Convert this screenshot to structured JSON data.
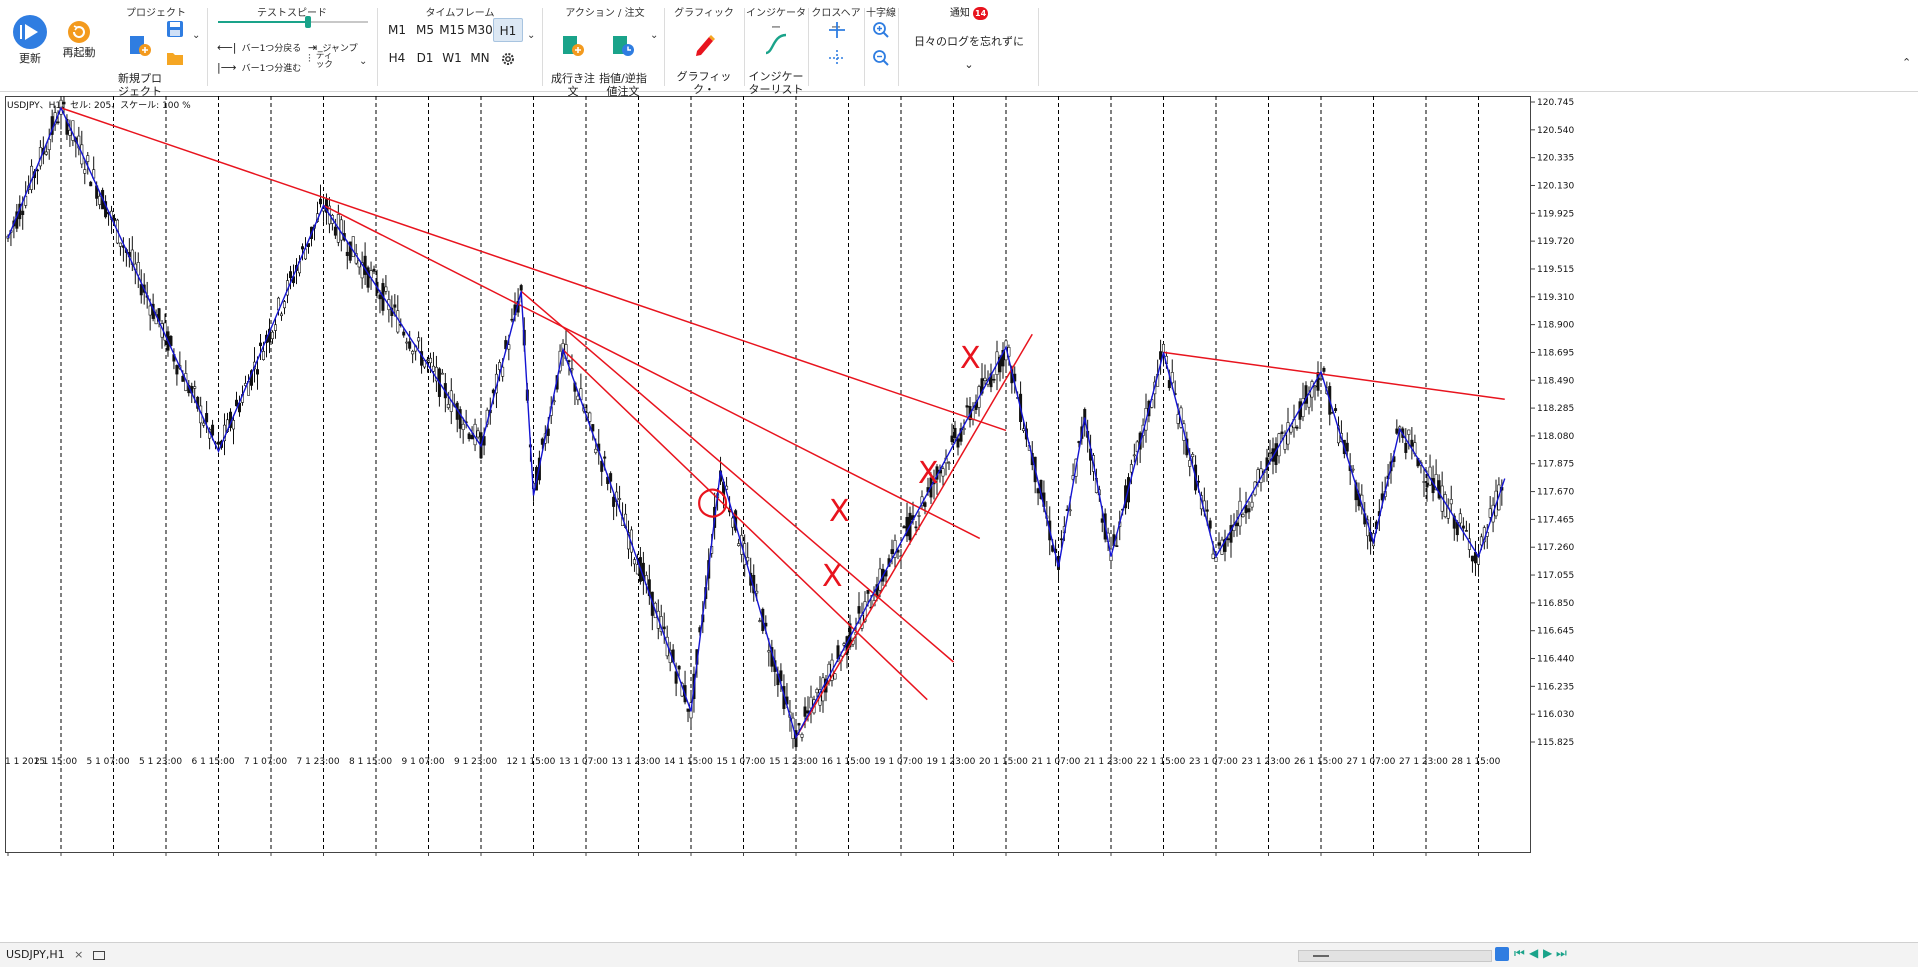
{
  "toolbar": {
    "refresh_label": "更新",
    "restart_label": "再起動",
    "project": {
      "title": "プロジェクト",
      "new_project_label": "新規プロ\nジェクト"
    },
    "test_speed": {
      "title": "テストスピード",
      "back_one_bar": "バー1つ分戻る",
      "forward_one_bar": "バー1つ分進む",
      "jump": "ジャンプ",
      "tick": "ティ\nック",
      "speed_fraction": 0.6
    },
    "timeframe": {
      "title": "タイムフレーム",
      "items": [
        "M1",
        "M5",
        "M15",
        "M30",
        "H1",
        "H4",
        "D1",
        "W1",
        "MN"
      ],
      "selected": "H1"
    },
    "action": {
      "title": "アクション / 注文",
      "market_order": "成行き注\n文",
      "limit_stop_order": "指値/逆指\n値注文"
    },
    "graphic": {
      "title": "グラフィック",
      "elements_label": "グラフィック・\nエレメント"
    },
    "indicator": {
      "title": "インジケーター",
      "list_label": "インジケー\nターリスト"
    },
    "crosshair": {
      "title": "クロスヘアー"
    },
    "cross_lines": {
      "title": "十字線"
    },
    "notification": {
      "title": "通知",
      "badge": "14",
      "message": "日々のログを忘れずに"
    }
  },
  "chart": {
    "info": "USDJPY、H1、セル: 205、スケール: 100 %",
    "price_labels": [
      "120.745",
      "120.540",
      "120.335",
      "120.130",
      "119.925",
      "119.720",
      "119.515",
      "119.310",
      "118.900",
      "118.695",
      "118.490",
      "118.285",
      "118.080",
      "117.875",
      "117.670",
      "117.465",
      "117.260",
      "117.055",
      "116.850",
      "116.645",
      "116.440",
      "116.235",
      "116.030",
      "115.825"
    ],
    "time_labels": [
      "1 1 2015",
      "2 1 15:00",
      "5 1 07:00",
      "5 1 23:00",
      "6 1 15:00",
      "7 1 07:00",
      "7 1 23:00",
      "8 1 15:00",
      "9 1 07:00",
      "9 1 23:00",
      "12 1 15:00",
      "13 1 07:00",
      "13 1 23:00",
      "14 1 15:00",
      "15 1 07:00",
      "15 1 23:00",
      "16 1 15:00",
      "19 1 07:00",
      "19 1 23:00",
      "20 1 15:00",
      "21 1 07:00",
      "21 1 23:00",
      "22 1 15:00",
      "23 1 07:00",
      "23 1 23:00",
      "26 1 15:00",
      "27 1 07:00",
      "27 1 23:00",
      "28 1 15:00"
    ],
    "marks": {
      "cross": "X",
      "circle": "○"
    },
    "colors": {
      "zigzag": "#1414d2",
      "trendline": "#e8141e",
      "candle": "#111111",
      "grid": "#000000"
    }
  },
  "chart_data": {
    "type": "candlestick",
    "symbol": "USDJPY",
    "timeframe": "H1",
    "ylim": [
      115.75,
      120.85
    ],
    "zigzag": [
      {
        "x": "1 1 2015",
        "y": 119.7
      },
      {
        "x": "2 1 15:00",
        "y": 120.7
      },
      {
        "x": "6 1 15:00",
        "y": 118.06
      },
      {
        "x": "7 1 23:00",
        "y": 119.95
      },
      {
        "x": "9 1 23:00",
        "y": 118.1
      },
      {
        "x": "12 1 00:00",
        "y": 119.29
      },
      {
        "x": "12 1 15:00",
        "y": 117.72
      },
      {
        "x": "13 1 00:00",
        "y": 118.84
      },
      {
        "x": "14 1 15:00",
        "y": 116.06
      },
      {
        "x": "15 1 00:00",
        "y": 117.91
      },
      {
        "x": "15 1 23:00",
        "y": 115.86
      },
      {
        "x": "20 1 15:00",
        "y": 118.86
      },
      {
        "x": "21 1 07:00",
        "y": 117.17
      },
      {
        "x": "21 1 15:00",
        "y": 118.32
      },
      {
        "x": "21 1 23:00",
        "y": 117.25
      },
      {
        "x": "22 1 15:00",
        "y": 118.82
      },
      {
        "x": "23 1 07:00",
        "y": 117.25
      },
      {
        "x": "26 1 15:00",
        "y": 118.67
      },
      {
        "x": "27 1 07:00",
        "y": 117.36
      },
      {
        "x": "27 1 15:00",
        "y": 118.23
      },
      {
        "x": "28 1 15:00",
        "y": 117.25
      },
      {
        "x": "28 1 23:00",
        "y": 117.85
      }
    ],
    "trendlines": [
      {
        "from": {
          "x": "2 1 15:00",
          "y": 120.7
        },
        "to": {
          "x": "20 1 15:00",
          "y": 118.22
        }
      },
      {
        "from": {
          "x": "7 1 23:00",
          "y": 119.95
        },
        "to": {
          "x": "20 1 07:00",
          "y": 117.39
        }
      },
      {
        "from": {
          "x": "12 1 00:00",
          "y": 119.29
        },
        "to": {
          "x": "19 1 23:00",
          "y": 116.44
        }
      },
      {
        "from": {
          "x": "13 1 00:00",
          "y": 118.84
        },
        "to": {
          "x": "19 1 15:00",
          "y": 116.15
        }
      },
      {
        "from": {
          "x": "15 1 23:00",
          "y": 115.86
        },
        "to": {
          "x": "20 1 23:00",
          "y": 118.96
        }
      },
      {
        "from": {
          "x": "22 1 15:00",
          "y": 118.82
        },
        "to": {
          "x": "28 1 23:00",
          "y": 118.46
        }
      }
    ]
  }
}
